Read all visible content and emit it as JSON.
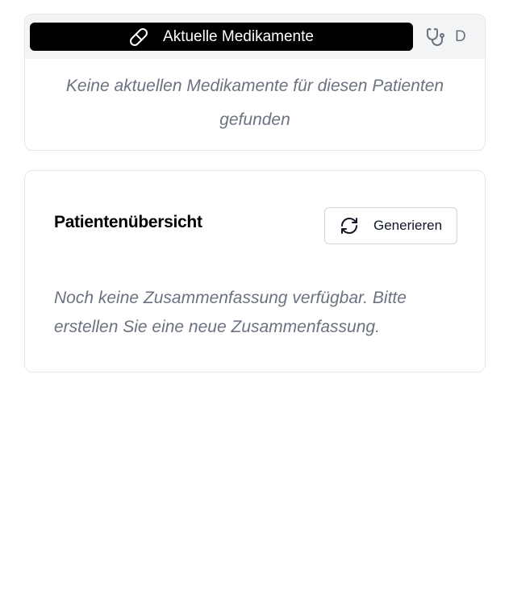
{
  "medications_card": {
    "tabs": [
      {
        "label": "Aktuelle Medikamente",
        "icon": "pill-icon",
        "active": true
      },
      {
        "label": "D",
        "icon": "stethoscope-icon",
        "active": false
      }
    ],
    "empty_text": "Keine aktuellen Medikamente für diesen Patienten gefunden"
  },
  "summary_card": {
    "title": "Patientenübersicht",
    "generate_button": {
      "label": "Generieren",
      "icon": "refresh-icon"
    },
    "empty_text": "Noch keine Zusammenfassung verfügbar. Bitte erstellen Sie eine neue Zusammenfassung."
  }
}
